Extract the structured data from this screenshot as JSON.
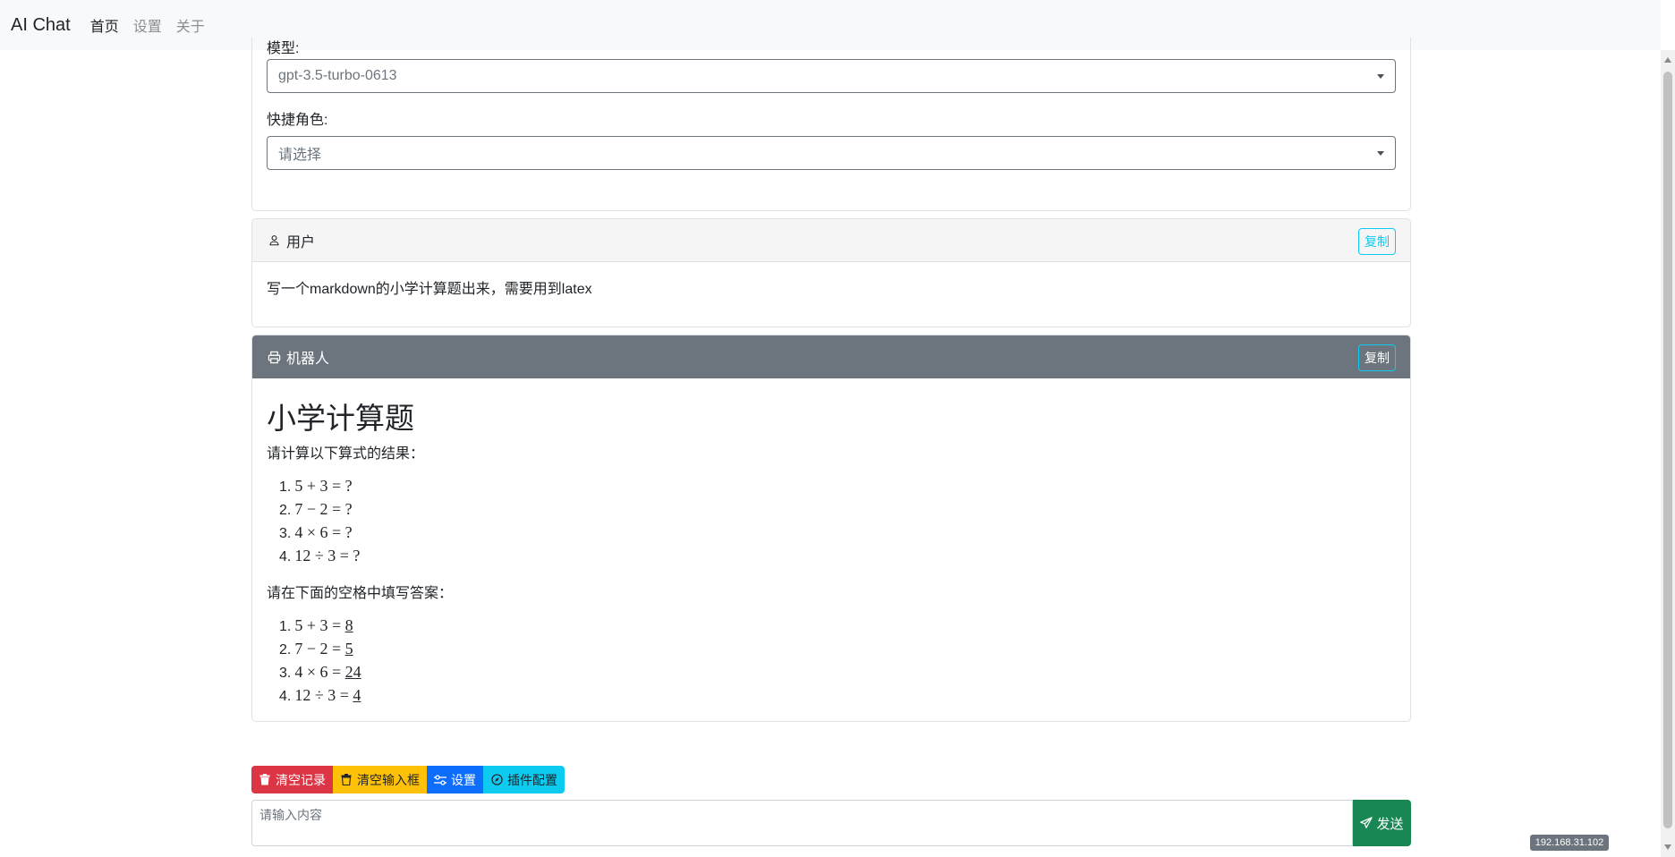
{
  "navbar": {
    "brand": "AI Chat",
    "links": [
      {
        "label": "首页",
        "active": true
      },
      {
        "label": "设置",
        "active": false
      },
      {
        "label": "关于",
        "active": false
      }
    ]
  },
  "settings": {
    "model_label": "模型:",
    "model_value": "gpt-3.5-turbo-0613",
    "role_label": "快捷角色:",
    "role_placeholder": "请选择"
  },
  "messages": {
    "user": {
      "role": "用户",
      "copy_label": "复制",
      "text": "写一个markdown的小学计算题出来，需要用到latex"
    },
    "bot": {
      "role": "机器人",
      "copy_label": "复制",
      "title": "小学计算题",
      "intro": "请计算以下算式的结果：",
      "questions": [
        "5 + 3 = ?",
        "7 − 2 = ?",
        "4 × 6 = ?",
        "12 ÷ 3 = ?"
      ],
      "answer_prompt": "请在下面的空格中填写答案：",
      "answers": [
        {
          "expr": "5 + 3 = ",
          "value": "8"
        },
        {
          "expr": "7 − 2 = ",
          "value": "5"
        },
        {
          "expr": "4 × 6 = ",
          "value": "24"
        },
        {
          "expr": "12 ÷ 3 = ",
          "value": "4"
        }
      ]
    }
  },
  "toolbar": {
    "clear_history": "清空记录",
    "clear_input": "清空输入框",
    "settings": "设置",
    "plugin_config": "插件配置"
  },
  "input": {
    "placeholder": "请输入内容",
    "send_label": "发送"
  },
  "ip_badge": "192.168.31.102",
  "colors": {
    "danger": "#dc3545",
    "warning": "#ffc107",
    "primary": "#0d6efd",
    "info": "#0dcaf0",
    "success": "#198754",
    "secondary": "#6c757d"
  }
}
